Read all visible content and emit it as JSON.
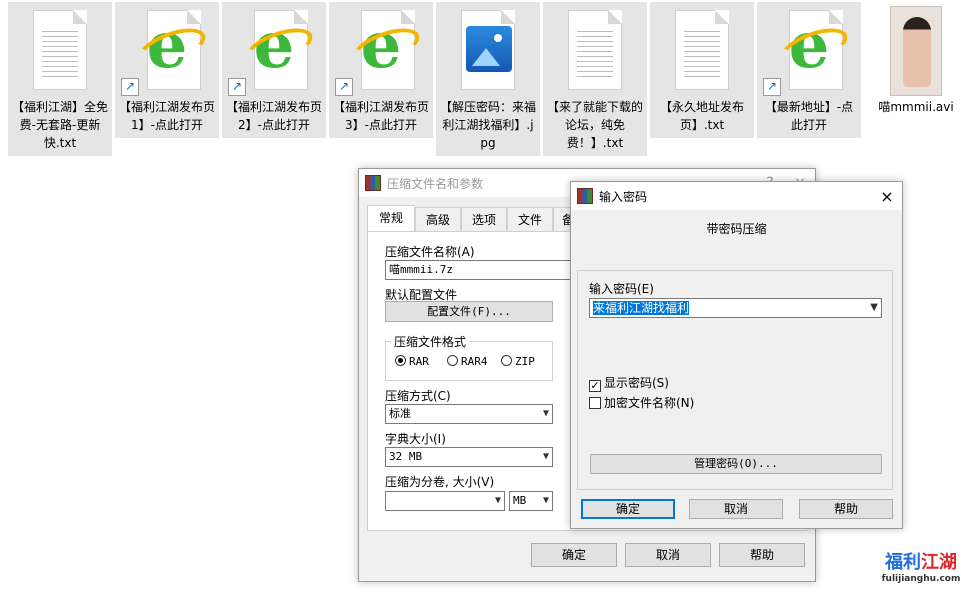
{
  "files": [
    {
      "name": "【福利江湖】全免费-无套路-更新快.txt",
      "icon": "text-file-icon",
      "state": "grey"
    },
    {
      "name": "【福利江湖发布页1】-点此打开",
      "icon": "ie-shortcut-icon",
      "state": "grey"
    },
    {
      "name": "【福利江湖发布页2】-点此打开",
      "icon": "ie-shortcut-icon",
      "state": "grey"
    },
    {
      "name": "【福利江湖发布页3】-点此打开",
      "icon": "ie-shortcut-icon",
      "state": "grey"
    },
    {
      "name": "【解压密码：来福利江湖找福利】.jpg",
      "icon": "image-file-icon",
      "state": "grey"
    },
    {
      "name": "【来了就能下载的论坛，纯免费！】.txt",
      "icon": "text-file-icon",
      "state": "grey"
    },
    {
      "name": "【永久地址发布页】.txt",
      "icon": "text-file-icon",
      "state": "grey"
    },
    {
      "name": "【最新地址】-点此打开",
      "icon": "ie-shortcut-icon",
      "state": "grey"
    },
    {
      "name": "喵mmmii.avi",
      "icon": "video-thumbnail-icon",
      "state": "none"
    }
  ],
  "archive_dialog": {
    "title": "压缩文件名和参数",
    "help_ctl": "?",
    "close_ctl": "×",
    "tabs": [
      "常规",
      "高级",
      "选项",
      "文件",
      "备"
    ],
    "active_tab": 0,
    "archive_name_label": "压缩文件名称(A)",
    "archive_name_value": "喵mmmii.7z",
    "default_profile_label": "默认配置文件",
    "profile_button": "配置文件(F)...",
    "format_group_label": "压缩文件格式",
    "formats": [
      "RAR",
      "RAR4",
      "ZIP"
    ],
    "selected_format": "RAR",
    "method_label": "压缩方式(C)",
    "method_value": "标准",
    "dict_label": "字典大小(I)",
    "dict_value": "32 MB",
    "split_label": "压缩为分卷, 大小(V)",
    "split_value": "",
    "split_unit": "MB",
    "ok": "确定",
    "cancel": "取消",
    "help": "帮助"
  },
  "password_dialog": {
    "title": "输入密码",
    "close_ctl": "×",
    "heading": "带密码压缩",
    "password_label": "输入密码(E)",
    "password_value": "来福利江湖找福利",
    "show_password_label": "显示密码(S)",
    "show_password_checked": true,
    "encrypt_names_label": "加密文件名称(N)",
    "encrypt_names_checked": false,
    "manage_button": "管理密码(O)...",
    "ok": "确定",
    "cancel": "取消",
    "help": "帮助"
  },
  "watermark": {
    "brand": "福利江湖",
    "url": "fulijianghu.com",
    "colors": {
      "blue": "#1f6fe0",
      "red": "#e0242a"
    }
  }
}
